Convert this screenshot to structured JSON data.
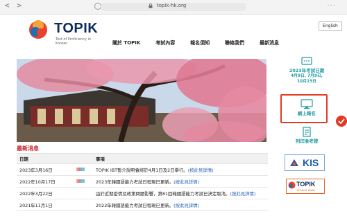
{
  "browser": {
    "url": "topik-hk.org",
    "back": "<",
    "forward": ">",
    "menu": "···"
  },
  "logo": {
    "title": "TOPIK",
    "subtitle": "Test of Proficiency in Korean"
  },
  "header": {
    "language_button": "English"
  },
  "nav": [
    "關於 TOPIK",
    "考試內容",
    "報名須知",
    "聯絡我們",
    "最新消息"
  ],
  "news": {
    "title": "最新消息",
    "columns": [
      "日期",
      "事項"
    ],
    "rows": [
      {
        "date": "2023年3月16日",
        "text": "TOPIK IBT暫介說明會將於4月1日及2日舉行。",
        "link": "(按此見詳情)"
      },
      {
        "date": "2022年10月17日",
        "text": "2023年韓國語能力考試日程現已更新。",
        "link": "(按此見詳情)"
      },
      {
        "date": "2022年3月22日",
        "text": "由於近期疫情及政策問題影響，第81回韓國語能力考試已決定取消。",
        "link": "(按此見詳情)"
      },
      {
        "date": "2021年11月1日",
        "text": "2022年韓國語能力考試日程現已更新。",
        "link": "(按此見詳情)"
      }
    ]
  },
  "sidebar": {
    "exam_dates_title": "2023年考試日期",
    "exam_dates_line1": "4月9日, 7月9日,",
    "exam_dates_line2": "10月15日",
    "online_register": "網上報名",
    "print_admission": "列印准考證",
    "kis_label": "KIS",
    "topik_world": "TOPIK",
    "topik_world_sub": "WORLD WIDE"
  },
  "colors": {
    "accent": "#1f9ba3",
    "highlight": "#e33b22",
    "news_red": "#c0282d",
    "brand_navy": "#0d2b5e"
  }
}
